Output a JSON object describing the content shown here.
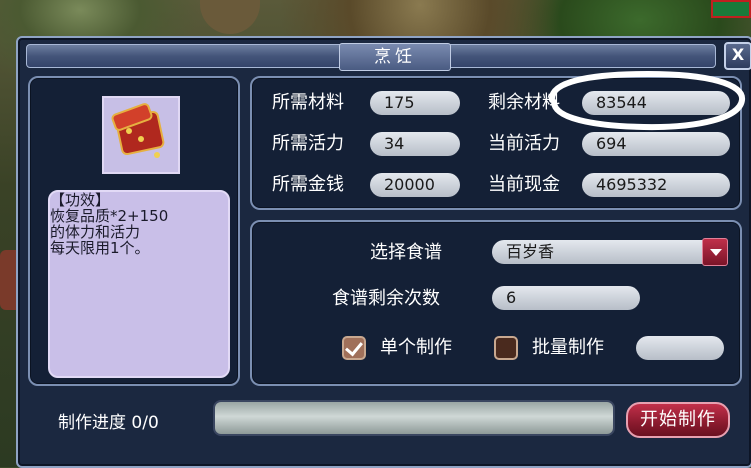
{
  "window": {
    "title": "烹饪",
    "close_label": "X"
  },
  "item": {
    "icon": "treasure-chest-icon",
    "effect_lines": [
      "【功效】",
      "恢复品质*2+150",
      "的体力和活力",
      "每天限用1个。"
    ]
  },
  "stats": {
    "required_material_label": "所需材料",
    "required_material_value": "175",
    "remaining_material_label": "剩余材料",
    "remaining_material_value": "83544",
    "required_vitality_label": "所需活力",
    "required_vitality_value": "34",
    "current_vitality_label": "当前活力",
    "current_vitality_value": "694",
    "required_money_label": "所需金钱",
    "required_money_value": "20000",
    "current_cash_label": "当前现金",
    "current_cash_value": "4695332"
  },
  "recipe": {
    "select_label": "选择食谱",
    "selected": "百岁香",
    "remaining_label": "食谱剩余次数",
    "remaining_value": "6"
  },
  "mode": {
    "single_label": "单个制作",
    "single_checked": true,
    "batch_label": "批量制作",
    "batch_checked": false,
    "batch_quantity": ""
  },
  "progress": {
    "label": "制作进度 0/0",
    "fraction": 0
  },
  "start_button": "开始制作",
  "colors": {
    "highlight": "#ffffff",
    "accent_red": "#a0203a",
    "panel_border": "#7b8fb2"
  }
}
